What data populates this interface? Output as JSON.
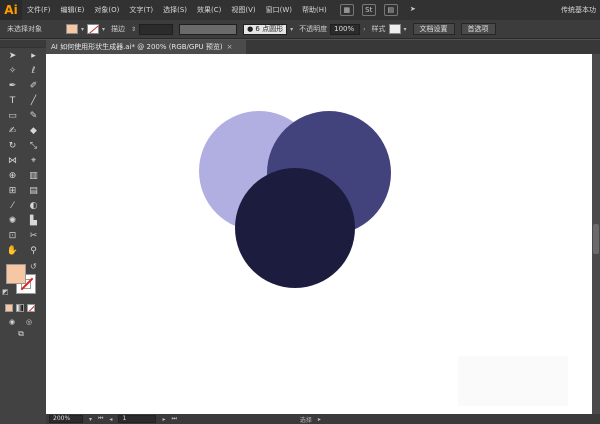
{
  "app": {
    "logo": "Ai",
    "workspace": "传统基本功"
  },
  "menu": {
    "items": [
      "文件(F)",
      "编辑(E)",
      "对象(O)",
      "文字(T)",
      "选择(S)",
      "效果(C)",
      "视图(V)",
      "窗口(W)",
      "帮助(H)"
    ],
    "icon_st": "St"
  },
  "control": {
    "no_selection": "未选择对象",
    "stroke_label": "描边",
    "brush": "6 点圆形",
    "opacity_label": "不透明度",
    "opacity_value": "100%",
    "style_label": "样式",
    "doc_setup": "文档设置",
    "prefs": "首选项",
    "fill_color": "#f7c6a3"
  },
  "document": {
    "tab_title": "AI 如何使用形状生成器.ai* @ 200% (RGB/GPU 预览)",
    "close": "×"
  },
  "status": {
    "zoom": "200%",
    "page": "1",
    "tool": "选择"
  },
  "artwork": {
    "circles": [
      {
        "name": "light-lavender-circle",
        "color": "#b1afe2"
      },
      {
        "name": "indigo-circle",
        "color": "#42427c"
      },
      {
        "name": "dark-navy-circle",
        "color": "#1c1c3e"
      }
    ]
  }
}
